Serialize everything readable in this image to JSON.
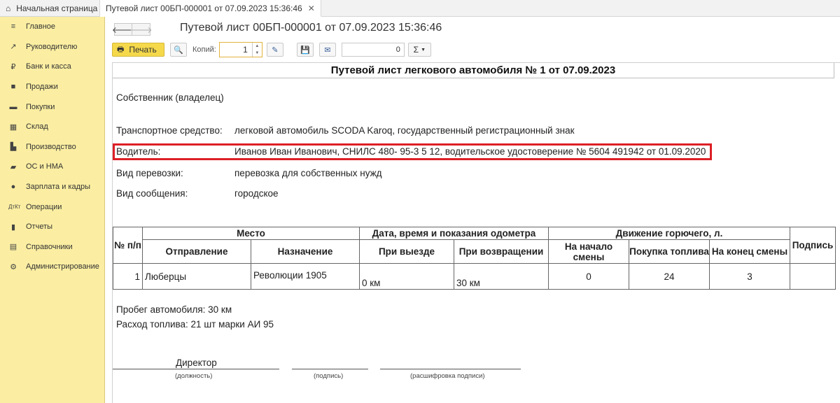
{
  "tabs": {
    "home": "Начальная страница",
    "active": "Путевой лист 00БП-000001 от 07.09.2023 15:36:46"
  },
  "sidebar": {
    "items": [
      {
        "label": "Главное",
        "icon": "menu-icon"
      },
      {
        "label": "Руководителю",
        "icon": "trend-icon"
      },
      {
        "label": "Банк и касса",
        "icon": "ruble-icon"
      },
      {
        "label": "Продажи",
        "icon": "bag-icon"
      },
      {
        "label": "Покупки",
        "icon": "cart-icon"
      },
      {
        "label": "Склад",
        "icon": "grid-icon"
      },
      {
        "label": "Производство",
        "icon": "factory-icon"
      },
      {
        "label": "ОС и НМА",
        "icon": "truck-icon"
      },
      {
        "label": "Зарплата и кадры",
        "icon": "person-icon"
      },
      {
        "label": "Операции",
        "icon": "dt-kt-icon"
      },
      {
        "label": "Отчеты",
        "icon": "bar-chart-icon"
      },
      {
        "label": "Справочники",
        "icon": "book-icon"
      },
      {
        "label": "Администрирование",
        "icon": "gear-icon"
      }
    ]
  },
  "form": {
    "title": "Путевой лист 00БП-000001 от 07.09.2023 15:36:46"
  },
  "toolbar": {
    "print_label": "Печать",
    "copies_label": "Копий:",
    "copies_value": "1",
    "sum_value": "0",
    "sum_symbol": "Σ"
  },
  "document": {
    "title": "Путевой лист легкового автомобиля № 1 от 07.09.2023",
    "owner_label": "Собственник (владелец)",
    "vehicle_label": "Транспортное средство:",
    "vehicle_value": "легковой автомобиль SCODA Karoq, государственный регистрационный знак",
    "driver_label": "Водитель:",
    "driver_value": "Иванов Иван Иванович, СНИЛС 480- 95-3 5 12, водительское удостоверение № 5604 491942 от 01.09.2020",
    "transport_type_label": "Вид перевозки:",
    "transport_type_value": "перевозка для собственных нужд",
    "route_type_label": "Вид сообщения:",
    "route_type_value": "городское",
    "table": {
      "headers": {
        "num": "№ п/п",
        "place": "Место",
        "datetime": "Дата, время и показания одометра",
        "fuel": "Движение горючего, л.",
        "signature": "Подпись",
        "departure": "Отправление",
        "destination": "Назначение",
        "on_exit": "При выезде",
        "on_return": "При возвращении",
        "fuel_start": "На начало смены",
        "fuel_purchase": "Покупка топлива",
        "fuel_end": "На конец смены"
      },
      "rows": [
        {
          "num": "1",
          "departure": "Люберцы",
          "destination": "Революции 1905",
          "on_exit": "0 км",
          "on_return": "30 км",
          "fuel_start": "0",
          "fuel_purchase": "24",
          "fuel_end": "3",
          "signature": ""
        }
      ]
    },
    "mileage": "Пробег автомобиля: 30 км",
    "fuel_consumption": "Расход топлива: 21 шт марки АИ 95",
    "position_value": "Директор",
    "caption_position": "(должность)",
    "caption_signature": "(подпись)",
    "caption_name": "(расшифровка подписи)"
  },
  "colors": {
    "sidebar_bg": "#fbeea2",
    "print_button": "#f5d94b",
    "highlight": "#dd1f26"
  }
}
